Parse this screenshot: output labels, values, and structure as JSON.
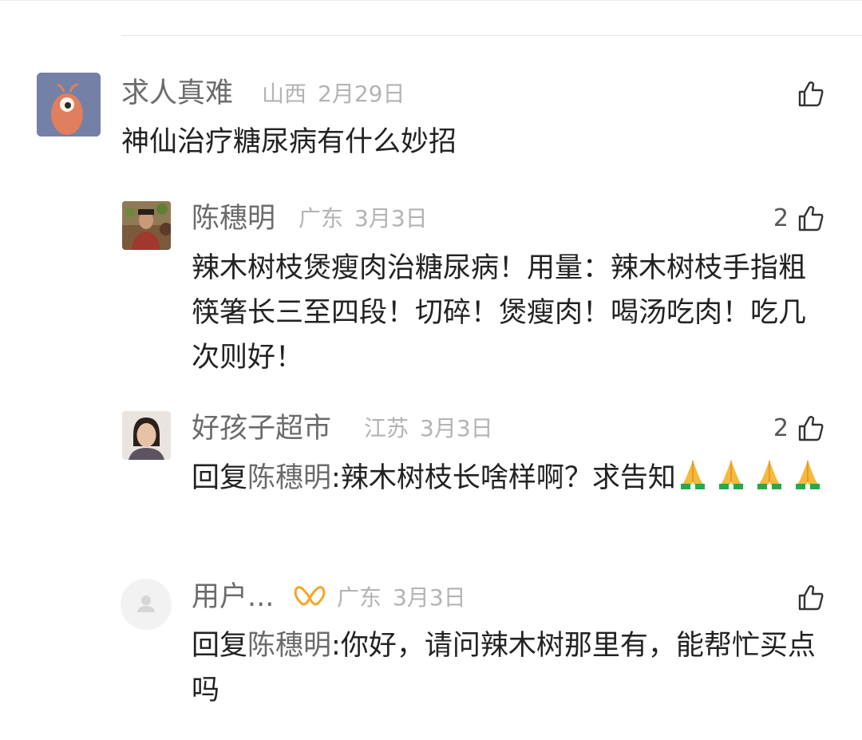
{
  "comments": [
    {
      "name": "求人真难",
      "location": "山西",
      "date": "2月29日",
      "likes": "",
      "text": "神仙治疗糖尿病有什么妙招"
    },
    {
      "name": "陈穗明",
      "location": "广东",
      "date": "3月3日",
      "likes": "2",
      "text": "辣木树枝煲瘦肉治糖尿病！用量：辣木树枝手指粗筷箸长三至四段！切碎！煲瘦肉！喝汤吃肉！吃几次则好！"
    },
    {
      "name": "好孩子超市",
      "location": "江苏",
      "date": "3月3日",
      "likes": "2",
      "reply_prefix": "回复",
      "reply_target": "陈穗明",
      "text": ":辣木树枝长啥样啊？求告知"
    },
    {
      "name": "用户",
      "name_suffix": "...",
      "location": "广东",
      "date": "3月3日",
      "likes": "",
      "reply_prefix": "回复",
      "reply_target": "陈穗明",
      "text": ":你好，请问辣木树那里有，能帮忙买点吗"
    }
  ],
  "icons": {
    "like": "thumbs-up-icon",
    "pray": "folded-hands-emoji",
    "badge": "orange-wing-badge-icon",
    "default_avatar": "person-silhouette-icon"
  },
  "colors": {
    "text": "#222222",
    "name": "#6b6b6b",
    "meta": "#b3b3b3",
    "badge": "#f5a623"
  }
}
